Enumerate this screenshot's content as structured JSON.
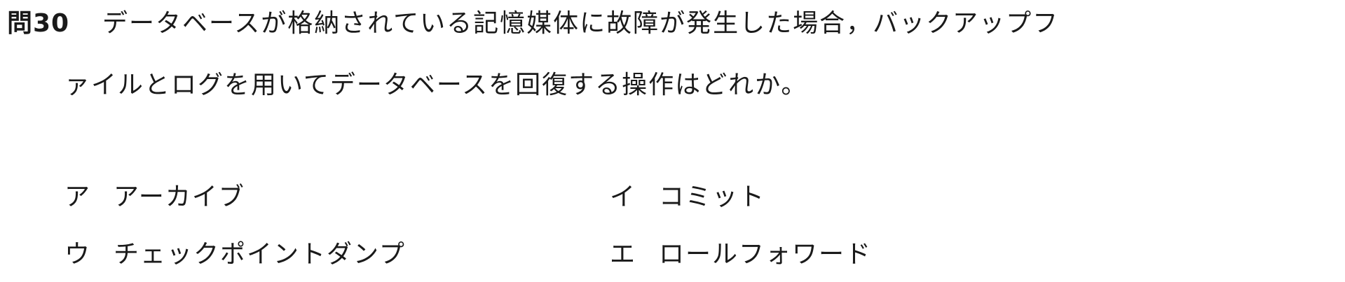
{
  "question": {
    "number": "問30",
    "line1": "データベースが格納されている記憶媒体に故障が発生した場合，バックアップフ",
    "line2": "ァイルとログを用いてデータベースを回復する操作はどれか。"
  },
  "choices": [
    {
      "letter": "ア",
      "text": "アーカイブ"
    },
    {
      "letter": "イ",
      "text": "コミット"
    },
    {
      "letter": "ウ",
      "text": "チェックポイントダンプ"
    },
    {
      "letter": "エ",
      "text": "ロールフォワード"
    }
  ]
}
